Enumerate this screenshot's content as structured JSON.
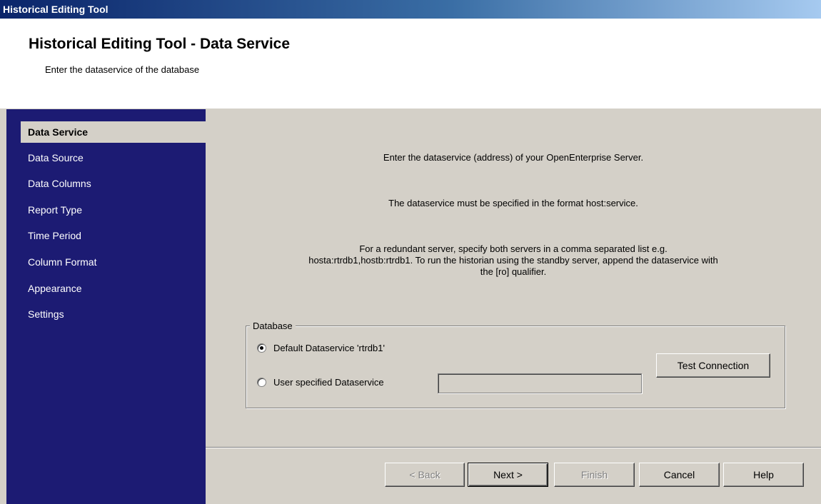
{
  "window": {
    "title": "Historical Editing Tool"
  },
  "header": {
    "title": "Historical Editing Tool - Data Service",
    "subtitle": "Enter the dataservice of the database"
  },
  "sidebar": {
    "items": [
      {
        "label": "Data Service",
        "active": true
      },
      {
        "label": "Data Source"
      },
      {
        "label": "Data Columns"
      },
      {
        "label": "Report Type"
      },
      {
        "label": "Time Period"
      },
      {
        "label": "Column Format"
      },
      {
        "label": "Appearance"
      },
      {
        "label": "Settings"
      }
    ]
  },
  "main": {
    "intro": "Enter the dataservice (address) of your OpenEnterprise Server.",
    "format_note": "The dataservice must be specified in the format host:service.",
    "redundant_line1": "For a redundant server, specify both servers in a comma separated list e.g.",
    "redundant_line2": "hosta:rtrdb1,hostb:rtrdb1. To run the historian using the standby server, append the dataservice with",
    "redundant_line3": "the [ro] qualifier.",
    "database": {
      "legend": "Database",
      "option_default": "Default Dataservice 'rtrdb1'",
      "option_user": "User specified Dataservice",
      "user_value": "",
      "selected": "default",
      "test_button": "Test Connection"
    }
  },
  "footer": {
    "back": "< Back",
    "next": "Next >",
    "finish": "Finish",
    "cancel": "Cancel",
    "help": "Help"
  },
  "colors": {
    "sidebar_bg": "#1c1b73",
    "face": "#d4d0c8",
    "titlebar_start": "#0a246a"
  }
}
